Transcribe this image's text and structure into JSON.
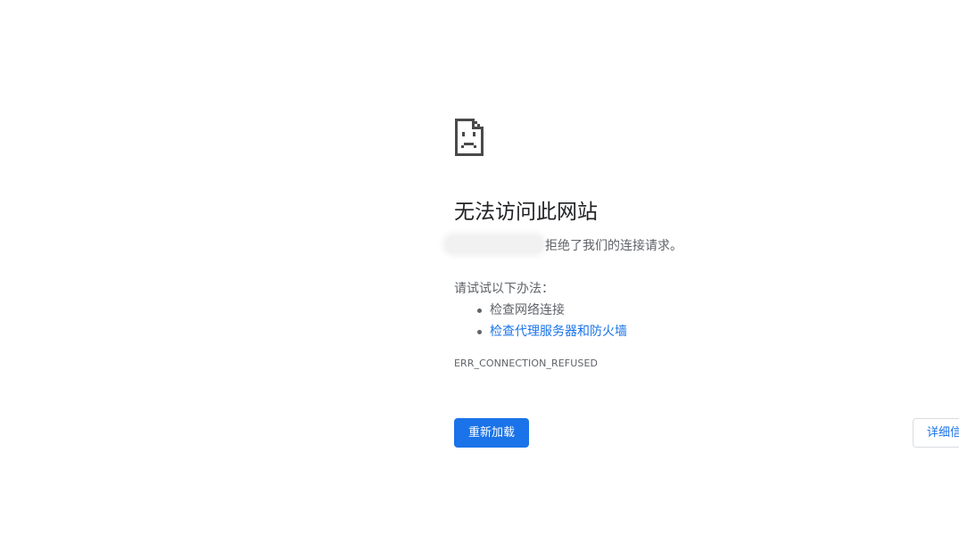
{
  "error_page": {
    "headline": "无法访问此网站",
    "summary_text": "拒绝了我们的连接请求。",
    "suggestions_intro": "请试试以下办法：",
    "suggestions": [
      {
        "label": "检查网络连接",
        "is_link": false
      },
      {
        "label": "检查代理服务器和防火墙",
        "is_link": true
      }
    ],
    "error_code": "ERR_CONNECTION_REFUSED",
    "reload_label": "重新加载",
    "details_label": "详细信息",
    "icon": "sad-page-icon"
  },
  "colors": {
    "accent": "#1a73e8",
    "text_primary": "#202124",
    "text_secondary": "#5f6368",
    "background": "#ffffff"
  }
}
